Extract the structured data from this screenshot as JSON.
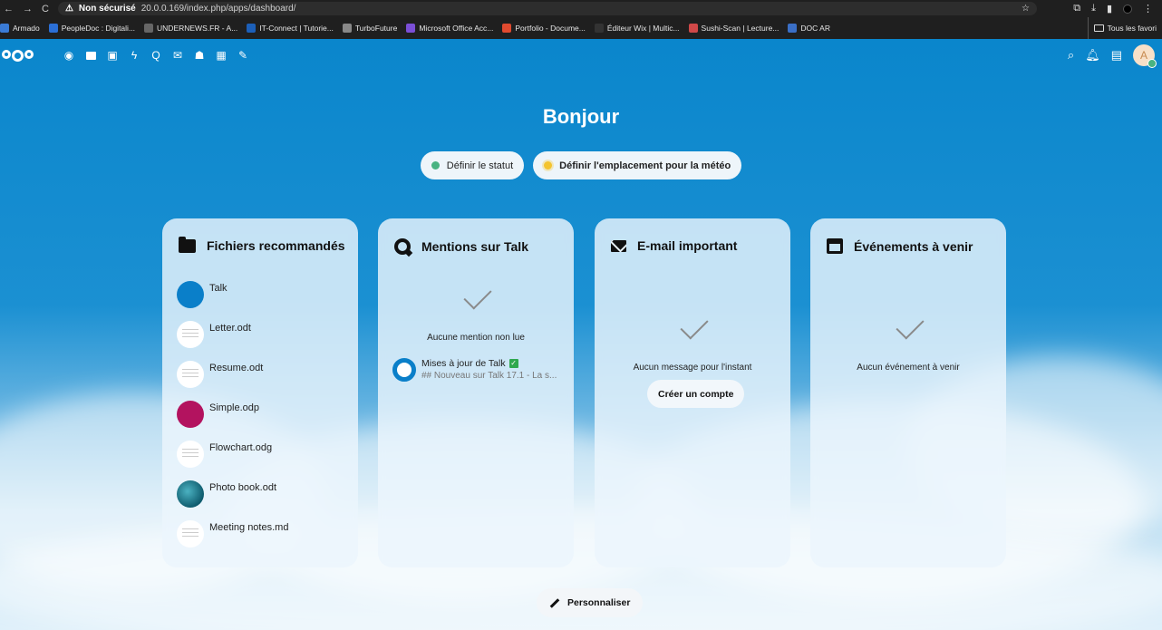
{
  "browser": {
    "security_label": "Non sécurisé",
    "url": "20.0.0.169/index.php/apps/dashboard/",
    "bookmarks": [
      {
        "label": "Armado",
        "color": "#3a7bd5"
      },
      {
        "label": "PeopleDoc : Digitali...",
        "color": "#2b6fd6"
      },
      {
        "label": "UNDERNEWS.FR - A...",
        "color": "#666666"
      },
      {
        "label": "IT-Connect | Tutorie...",
        "color": "#1c5fb8"
      },
      {
        "label": "TurboFuture",
        "color": "#888888"
      },
      {
        "label": "Microsoft Office Acc...",
        "color": "#7b4fd6"
      },
      {
        "label": "Portfolio - Docume...",
        "color": "#e04a2f"
      },
      {
        "label": "Éditeur Wix | Multic...",
        "color": "#333333"
      },
      {
        "label": "Sushi-Scan | Lecture...",
        "color": "#d04848"
      },
      {
        "label": "DOC AR",
        "color": "#3a6fc6"
      }
    ],
    "all_bookmarks_label": "Tous les favori"
  },
  "nav": {
    "avatar_initial": "A"
  },
  "greeting": "Bonjour",
  "status": {
    "set_status_label": "Définir le statut",
    "weather_label": "Définir l'emplacement pour la météo"
  },
  "widgets": {
    "files": {
      "title": "Fichiers recommandés",
      "items": [
        {
          "name": "Talk"
        },
        {
          "name": "Letter.odt"
        },
        {
          "name": "Resume.odt"
        },
        {
          "name": "Simple.odp"
        },
        {
          "name": "Flowchart.odg"
        },
        {
          "name": "Photo book.odt"
        },
        {
          "name": "Meeting notes.md"
        }
      ]
    },
    "talk": {
      "title": "Mentions sur Talk",
      "empty": "Aucune mention non lue",
      "item_title": "Mises à jour de Talk",
      "item_subtitle": "## Nouveau sur Talk 17.1 - La s..."
    },
    "mail": {
      "title": "E-mail important",
      "empty": "Aucun message pour l'instant",
      "create_account": "Créer un compte"
    },
    "events": {
      "title": "Événements à venir",
      "empty": "Aucun événement à venir"
    }
  },
  "customize_label": "Personnaliser"
}
